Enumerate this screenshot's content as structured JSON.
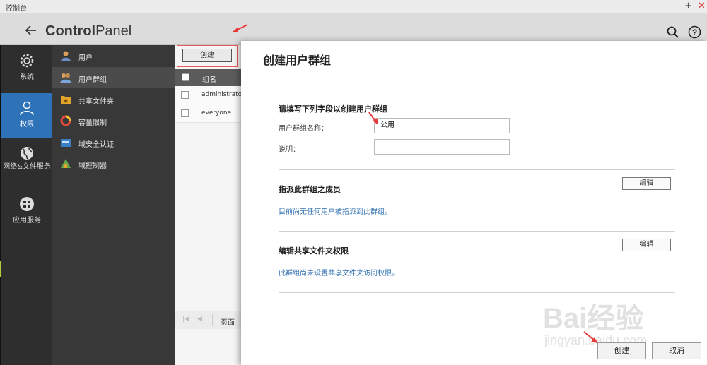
{
  "window": {
    "title": "控制台",
    "controls": {
      "minimize": "—",
      "maximize": "+",
      "close": "✕"
    }
  },
  "header": {
    "back_icon": "arrow-left",
    "title_bold": "Control",
    "title_rest": "Panel",
    "search_icon": "search",
    "help_icon": "help"
  },
  "rail": {
    "items": [
      {
        "label": "系统",
        "icon": "gear"
      },
      {
        "label": "权限",
        "icon": "user",
        "active": true
      },
      {
        "label": "网络&文件服务",
        "icon": "globe"
      },
      {
        "label": "应用服务",
        "icon": "apps"
      }
    ]
  },
  "submenu": {
    "items": [
      {
        "label": "用户",
        "icon": "user",
        "color": "#d9a15b"
      },
      {
        "label": "用户群组",
        "icon": "group",
        "color": "#7aa6d8",
        "active": true
      },
      {
        "label": "共享文件夹",
        "icon": "folder-share",
        "color": "#e0a52a"
      },
      {
        "label": "容量限制",
        "icon": "quota",
        "color": "#e04a3c"
      },
      {
        "label": "域安全认证",
        "icon": "domain",
        "color": "#3a7fc6"
      },
      {
        "label": "域控制器",
        "icon": "controller",
        "color": "#6aa84f"
      }
    ]
  },
  "list": {
    "create_label": "创建",
    "header": "组名",
    "rows": [
      "administrato",
      "everyone"
    ],
    "pager_label": "页面"
  },
  "dialog": {
    "title": "创建用户群组",
    "section1": {
      "title": "请填写下列字段以创建用户群组",
      "name_label": "用户群组名称：",
      "name_value": "公用",
      "desc_label": "说明：",
      "desc_value": ""
    },
    "section2": {
      "title": "指派此群组之成员",
      "edit_label": "编辑",
      "info": "目前尚无任何用户被指派到此群组。"
    },
    "section3": {
      "title": "编辑共享文件夹权限",
      "edit_label": "编辑",
      "info": "此群组尚未设置共享文件夹访问权限。"
    },
    "create_button": "创建",
    "cancel_button": "取消"
  },
  "watermark": {
    "brand": "Bai经验",
    "url": "jingyan.baidu.com"
  },
  "colors": {
    "accent": "#2e72b8",
    "annotation": "#e83a3a",
    "link": "#2f6fb0"
  }
}
